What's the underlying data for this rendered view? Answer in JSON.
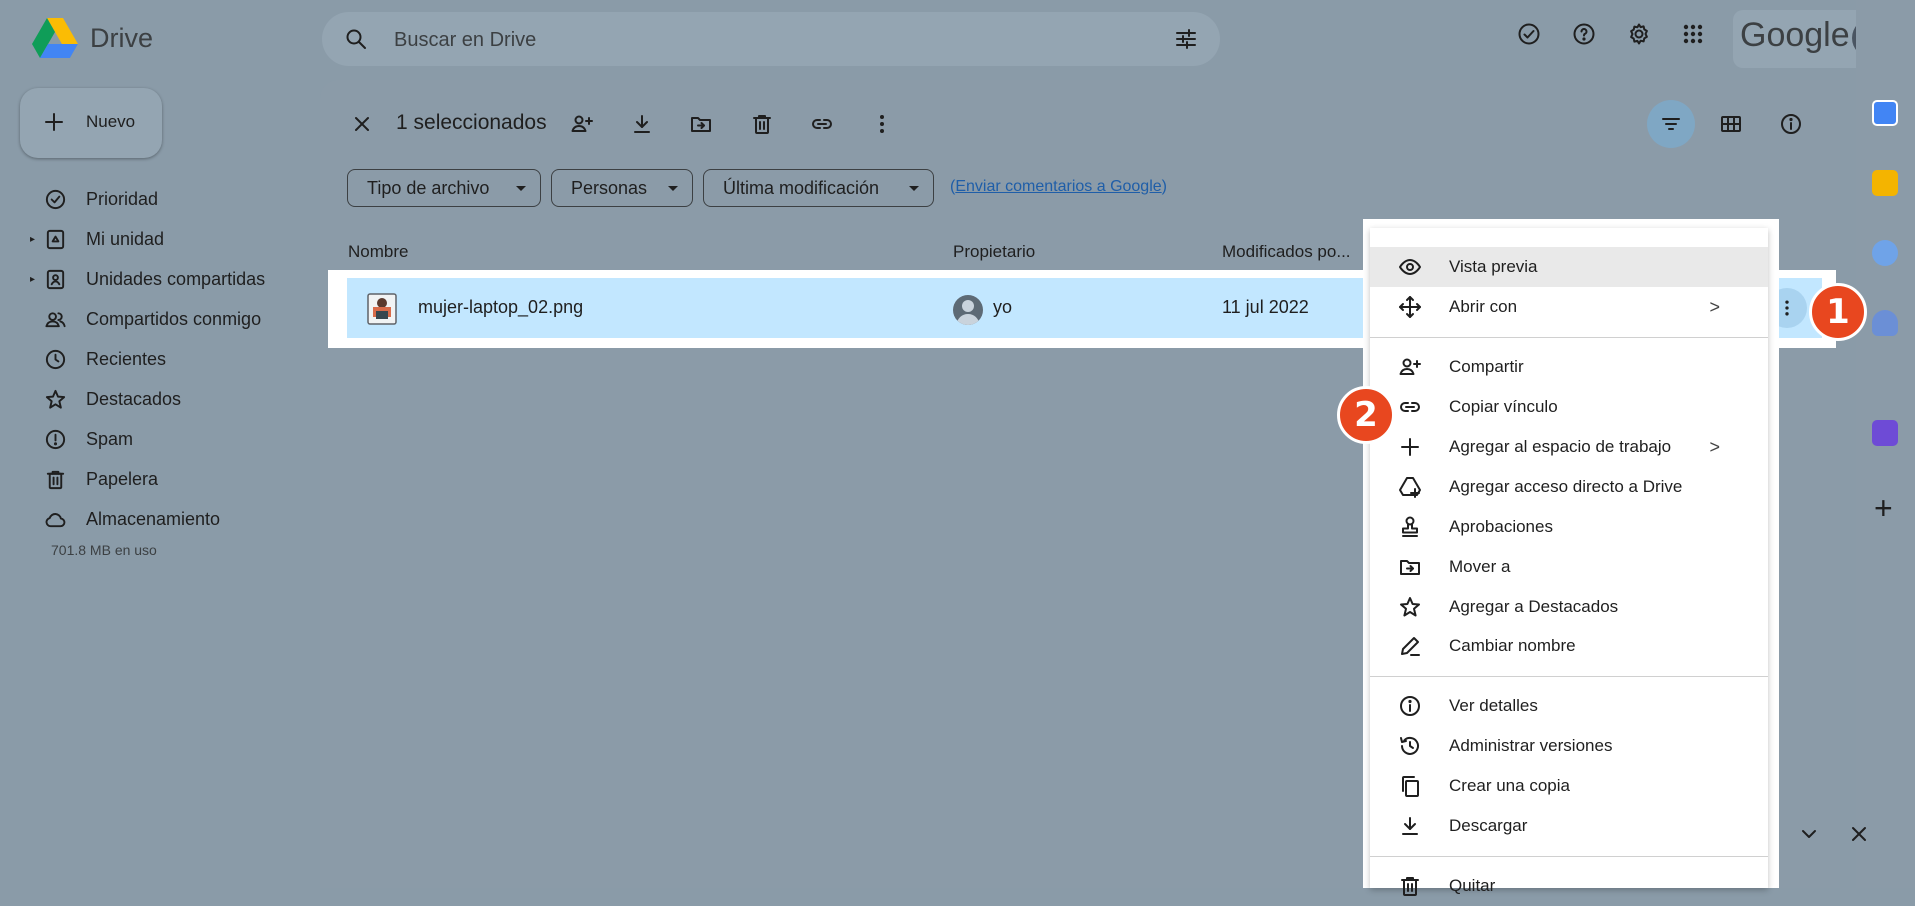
{
  "app": {
    "name": "Drive",
    "brand": "Google"
  },
  "search": {
    "placeholder": "Buscar en Drive"
  },
  "new_button": {
    "label": "Nuevo"
  },
  "sidebar": {
    "items": [
      {
        "label": "Prioridad",
        "icon": "check-circle-icon"
      },
      {
        "label": "Mi unidad",
        "icon": "drive-icon"
      },
      {
        "label": "Unidades compartidas",
        "icon": "shared-drives-icon"
      },
      {
        "label": "Compartidos conmigo",
        "icon": "people-icon"
      },
      {
        "label": "Recientes",
        "icon": "clock-icon"
      },
      {
        "label": "Destacados",
        "icon": "star-icon"
      },
      {
        "label": "Spam",
        "icon": "spam-icon"
      },
      {
        "label": "Papelera",
        "icon": "trash-icon"
      },
      {
        "label": "Almacenamiento",
        "icon": "cloud-icon"
      }
    ],
    "storage": "701.8 MB en uso"
  },
  "selection": {
    "count_label": "1 seleccionados"
  },
  "filters": {
    "chips": [
      "Tipo de archivo",
      "Personas",
      "Última modificación"
    ],
    "feedback_open": "(",
    "feedback_link": "Enviar comentarios a Google",
    "feedback_close": ")"
  },
  "table": {
    "columns": [
      "Nombre",
      "Propietario",
      "Modificados po..."
    ],
    "rows": [
      {
        "name": "mujer-laptop_02.png",
        "owner": "yo",
        "modified": "11 jul 2022"
      }
    ]
  },
  "context_menu": {
    "items": [
      {
        "label": "Vista previa",
        "icon": "eye-icon"
      },
      {
        "label": "Abrir con",
        "icon": "move-arrows-icon",
        "submenu": ">"
      },
      {
        "label": "Compartir",
        "icon": "person-add-icon"
      },
      {
        "label": "Copiar vínculo",
        "icon": "link-icon"
      },
      {
        "label": "Agregar al espacio de trabajo",
        "icon": "plus-icon",
        "submenu": ">"
      },
      {
        "label": "Agregar acceso directo a Drive",
        "icon": "drive-shortcut-icon"
      },
      {
        "label": "Aprobaciones",
        "icon": "stamp-icon"
      },
      {
        "label": "Mover a",
        "icon": "folder-move-icon"
      },
      {
        "label": "Agregar a Destacados",
        "icon": "star-icon"
      },
      {
        "label": "Cambiar nombre",
        "icon": "pencil-icon"
      },
      {
        "label": "Ver detalles",
        "icon": "info-icon"
      },
      {
        "label": "Administrar versiones",
        "icon": "history-icon"
      },
      {
        "label": "Crear una copia",
        "icon": "copy-icon"
      },
      {
        "label": "Descargar",
        "icon": "download-icon"
      },
      {
        "label": "Quitar",
        "icon": "trash-icon"
      }
    ]
  },
  "markers": [
    "1",
    "2"
  ],
  "colors": {
    "overlay_bg": "#8a9ba8",
    "selected_row": "#c2e7ff",
    "marker": "#e8471f",
    "link": "#1f5ea8"
  }
}
